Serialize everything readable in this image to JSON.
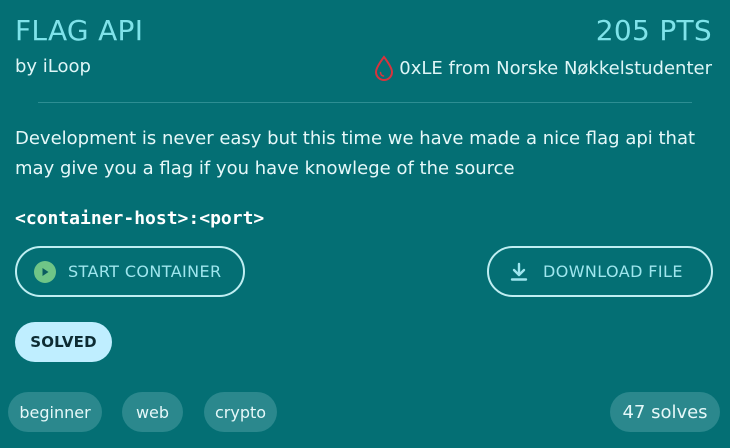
{
  "challenge": {
    "title": "FLAG API",
    "points": "205 PTS",
    "author": "by iLoop",
    "first_blood": "0xLE from Norske Nøkkelstudenter",
    "description": "Development is never easy but this time we have made a nice flag api that may give you a flag if you have knowlege of the source",
    "connection": "<container-host>:<port>",
    "status": "SOLVED",
    "tags": [
      "beginner",
      "web",
      "crypto"
    ],
    "solves": "47 solves"
  },
  "actions": {
    "start_container": "START CONTAINER",
    "download_file": "DOWNLOAD FILE"
  },
  "icons": {
    "first_blood": "blood-drop-icon",
    "start": "play-icon",
    "download": "download-icon"
  },
  "colors": {
    "background": "#046f74",
    "accent": "#7fe3ea",
    "blood": "#d9333d",
    "play": "#6fc587",
    "solved_badge": "#bfeeff"
  }
}
